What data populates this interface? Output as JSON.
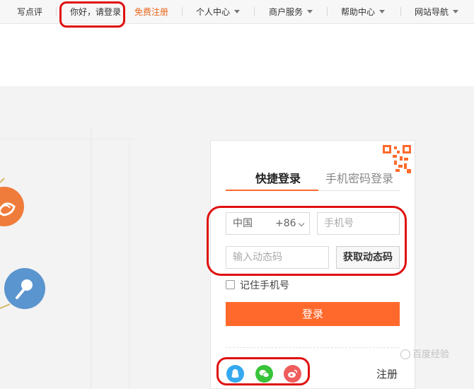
{
  "top_nav": {
    "write_review": "写点评",
    "greeting": "你好，请登录",
    "free_register": "免费注册",
    "personal_center": "个人中心",
    "merchant_services": "商户服务",
    "help_center": "帮助中心",
    "site_nav": "网站导航"
  },
  "login": {
    "tabs": [
      {
        "label": "快捷登录",
        "active": true
      },
      {
        "label": "手机密码登录",
        "active": false
      }
    ],
    "country": {
      "value": "中国",
      "code": "+86"
    },
    "phone_placeholder": "手机号",
    "code_placeholder": "输入动态码",
    "get_code_label": "获取动态码",
    "remember_label": "记住手机号",
    "remember_checked": false,
    "submit_label": "登录",
    "register_label": "注册",
    "social_icons": [
      "qq-icon",
      "wechat-icon",
      "weibo-icon"
    ]
  },
  "watermark": "百度经验",
  "colors": {
    "accent": "#ff6a2c",
    "register_link": "#e8651a",
    "highlight_oval": "#e01010",
    "qq": "#35a9f0",
    "wechat": "#39c33a",
    "weibo": "#ef5d5d"
  }
}
